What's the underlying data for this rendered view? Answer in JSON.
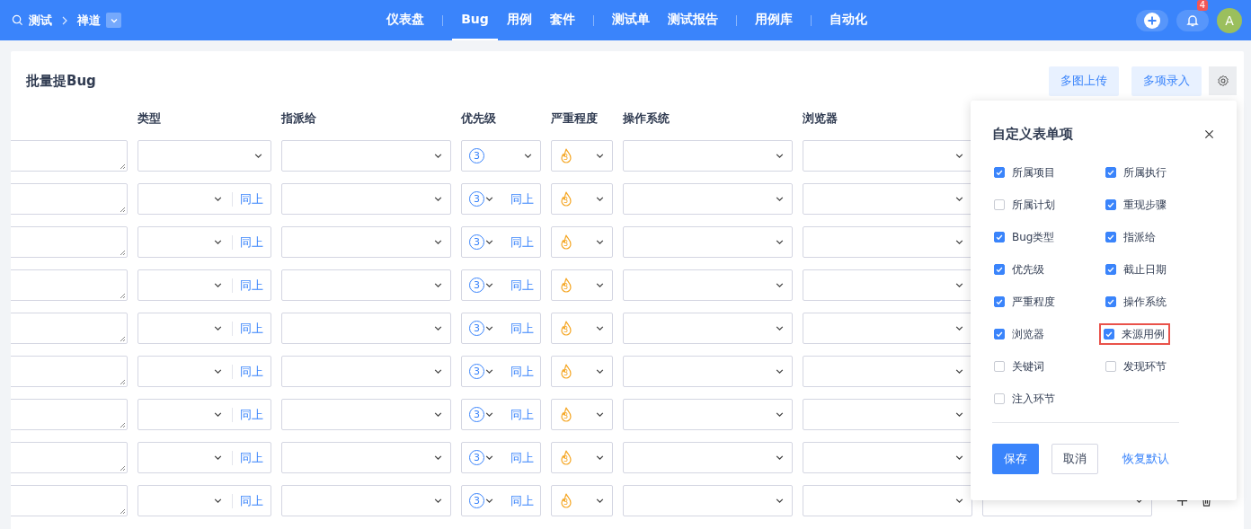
{
  "nav": {
    "product": "测试",
    "project": "禅道",
    "items": [
      {
        "label": "仪表盘",
        "selected": false,
        "group_start": false
      },
      {
        "label": "Bug",
        "selected": true,
        "group_start": true
      },
      {
        "label": "用例",
        "selected": false,
        "group_start": false
      },
      {
        "label": "套件",
        "selected": false,
        "group_start": false
      },
      {
        "label": "测试单",
        "selected": false,
        "group_start": true
      },
      {
        "label": "测试报告",
        "selected": false,
        "group_start": false
      },
      {
        "label": "用例库",
        "selected": false,
        "group_start": true
      },
      {
        "label": "自动化",
        "selected": false,
        "group_start": true
      }
    ],
    "notification_count": "4",
    "avatar": "A"
  },
  "page": {
    "title": "批量提Bug",
    "buttons": [
      "多图上传",
      "多项录入"
    ]
  },
  "table": {
    "columns": [
      "类型",
      "指派给",
      "优先级",
      "严重程度",
      "操作系统",
      "浏览器"
    ],
    "rows": [
      {
        "kind": "first",
        "priority": "3",
        "severity": "3"
      },
      {
        "kind": "same",
        "priority": "3",
        "severity": "3",
        "same_type": "同上",
        "same_priority": "同上"
      },
      {
        "kind": "same",
        "priority": "3",
        "severity": "3",
        "same_type": "同上",
        "same_priority": "同上"
      },
      {
        "kind": "same",
        "priority": "3",
        "severity": "3",
        "same_type": "同上",
        "same_priority": "同上"
      },
      {
        "kind": "same",
        "priority": "3",
        "severity": "3",
        "same_type": "同上",
        "same_priority": "同上"
      },
      {
        "kind": "same",
        "priority": "3",
        "severity": "3",
        "same_type": "同上",
        "same_priority": "同上"
      },
      {
        "kind": "same",
        "priority": "3",
        "severity": "3",
        "same_type": "同上",
        "same_priority": "同上"
      },
      {
        "kind": "same",
        "priority": "3",
        "severity": "3",
        "same_type": "同上",
        "same_priority": "同上"
      },
      {
        "kind": "last",
        "priority": "3",
        "severity": "3",
        "same_type": "同上",
        "same_priority": "同上"
      }
    ]
  },
  "popover": {
    "title": "自定义表单项",
    "fields": [
      {
        "label": "所属项目",
        "checked": true,
        "highlighted": false
      },
      {
        "label": "所属执行",
        "checked": true,
        "highlighted": false
      },
      {
        "label": "所属计划",
        "checked": false,
        "highlighted": false
      },
      {
        "label": "重现步骤",
        "checked": true,
        "highlighted": false
      },
      {
        "label": "Bug类型",
        "checked": true,
        "highlighted": false
      },
      {
        "label": "指派给",
        "checked": true,
        "highlighted": false
      },
      {
        "label": "优先级",
        "checked": true,
        "highlighted": false
      },
      {
        "label": "截止日期",
        "checked": true,
        "highlighted": false
      },
      {
        "label": "严重程度",
        "checked": true,
        "highlighted": false
      },
      {
        "label": "操作系统",
        "checked": true,
        "highlighted": false
      },
      {
        "label": "浏览器",
        "checked": true,
        "highlighted": false
      },
      {
        "label": "来源用例",
        "checked": true,
        "highlighted": true
      },
      {
        "label": "关键词",
        "checked": false,
        "highlighted": false
      },
      {
        "label": "发现环节",
        "checked": false,
        "highlighted": false
      },
      {
        "label": "注入环节",
        "checked": false,
        "highlighted": false
      }
    ],
    "save": "保存",
    "cancel": "取消",
    "reset": "恢复默认"
  }
}
